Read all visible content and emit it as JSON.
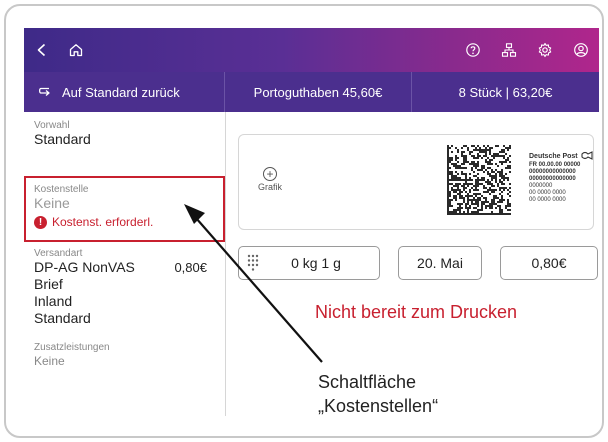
{
  "navbar": {
    "icons": [
      "back-icon",
      "home-icon",
      "help-icon",
      "network-icon",
      "settings-icon",
      "account-icon"
    ]
  },
  "subheader": {
    "back_label": "Auf Standard zurück",
    "balance": "Portoguthaben 45,60€",
    "pieces": "8 Stück | 63,20€"
  },
  "left_panel": {
    "vorwahl_label": "Vorwahl",
    "vorwahl_value": "Standard",
    "kostenstelle_label": "Kostenstelle",
    "kostenstelle_value": "Keine",
    "kostenstelle_error": "Kostenst. erforderl.",
    "versandart_label": "Versandart",
    "versandart_value": "DP-AG NonVAS",
    "versandart_price": "0,80€",
    "versandart_lines": [
      "Brief",
      "Inland",
      "Standard"
    ],
    "zusatz_label": "Zusatzleistungen",
    "zusatz_value": "Keine"
  },
  "stamp": {
    "grafik_label": "Grafik",
    "brand": "Deutsche Post",
    "fr_line": "FR 00.00.00 00000",
    "lines": [
      "00000000000000",
      "00000000000000",
      "0000000",
      "00 0000 0000",
      "00 0000 0000"
    ]
  },
  "controls": {
    "weight": "0 kg 1 g",
    "date": "20. Mai",
    "price": "0,80€"
  },
  "status": {
    "not_ready": "Nicht bereit zum Drucken"
  },
  "annotation": {
    "line1": "Schaltfläche",
    "line2": "„Kostenstellen“"
  },
  "colors": {
    "nav_gradient_start": "#3e2a88",
    "nav_gradient_end": "#b0268c",
    "subheader": "#4b2f8e",
    "error_red": "#c8202f"
  }
}
